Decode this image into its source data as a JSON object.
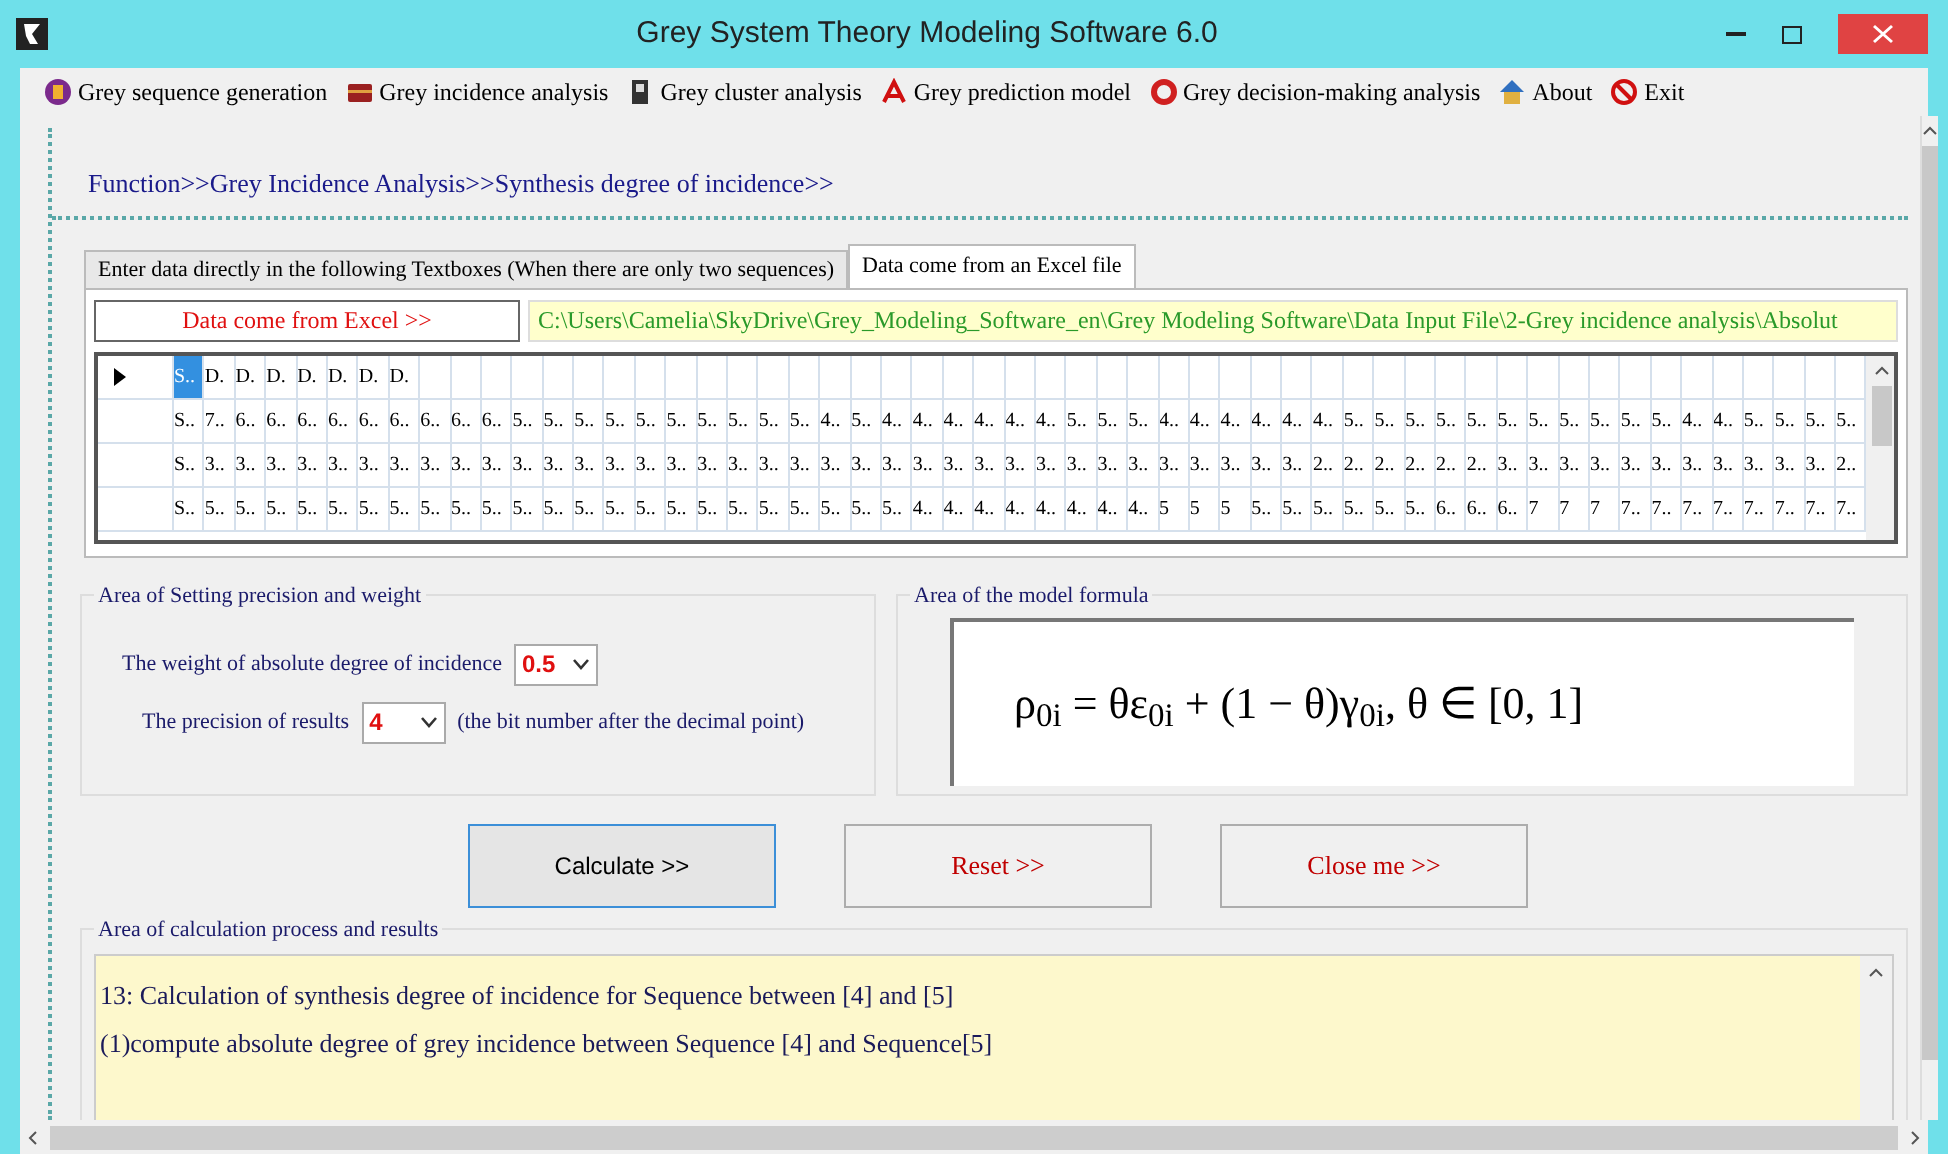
{
  "window": {
    "title": "Grey System Theory Modeling Software 6.0"
  },
  "menu": [
    {
      "label": "Grey sequence generation"
    },
    {
      "label": "Grey incidence analysis"
    },
    {
      "label": "Grey cluster analysis"
    },
    {
      "label": "Grey prediction model"
    },
    {
      "label": "Grey decision-making analysis"
    },
    {
      "label": "About"
    },
    {
      "label": "Exit"
    }
  ],
  "breadcrumb": "Function>>Grey Incidence Analysis>>Synthesis degree of incidence>>",
  "tabs": [
    {
      "label": "Enter data directly in the following Textboxes (When there are only two sequences)",
      "selected": false
    },
    {
      "label": "Data come from an Excel file",
      "selected": true
    }
  ],
  "excel_button": "Data come from Excel >>",
  "file_path": "C:\\Users\\Camelia\\SkyDrive\\Grey_Modeling_Software_en\\Grey Modeling Software\\Data Input File\\2-Grey incidence analysis\\Absolut",
  "grid": {
    "rows": [
      {
        "selected": true,
        "cells": [
          "S..",
          "D.",
          "D.",
          "D.",
          "D.",
          "D.",
          "D.",
          "D."
        ]
      },
      {
        "selected": false,
        "cells": [
          "S..",
          "7..",
          "6..",
          "6..",
          "6..",
          "6..",
          "6..",
          "6..",
          "6..",
          "6..",
          "6..",
          "5..",
          "5..",
          "5..",
          "5..",
          "5..",
          "5..",
          "5..",
          "5..",
          "5..",
          "5..",
          "4..",
          "5..",
          "4..",
          "4..",
          "4..",
          "4..",
          "4..",
          "4..",
          "5..",
          "5..",
          "5..",
          "4..",
          "4..",
          "4..",
          "4..",
          "4..",
          "4..",
          "5..",
          "5..",
          "5..",
          "5..",
          "5..",
          "5..",
          "5..",
          "5..",
          "5..",
          "5..",
          "5..",
          "4..",
          "4..",
          "5..",
          "5..",
          "5..",
          "5.."
        ]
      },
      {
        "selected": false,
        "cells": [
          "S..",
          "3..",
          "3..",
          "3..",
          "3..",
          "3..",
          "3..",
          "3..",
          "3..",
          "3..",
          "3..",
          "3..",
          "3..",
          "3..",
          "3..",
          "3..",
          "3..",
          "3..",
          "3..",
          "3..",
          "3..",
          "3..",
          "3..",
          "3..",
          "3..",
          "3..",
          "3..",
          "3..",
          "3..",
          "3..",
          "3..",
          "3..",
          "3..",
          "3..",
          "3..",
          "3..",
          "3..",
          "2..",
          "2..",
          "2..",
          "2..",
          "2..",
          "2..",
          "3..",
          "3..",
          "3..",
          "3..",
          "3..",
          "3..",
          "3..",
          "3..",
          "3..",
          "3..",
          "3..",
          "2.."
        ]
      },
      {
        "selected": false,
        "cells": [
          "S..",
          "5..",
          "5..",
          "5..",
          "5..",
          "5..",
          "5..",
          "5..",
          "5..",
          "5..",
          "5..",
          "5..",
          "5..",
          "5..",
          "5..",
          "5..",
          "5..",
          "5..",
          "5..",
          "5..",
          "5..",
          "5..",
          "5..",
          "5..",
          "4..",
          "4..",
          "4..",
          "4..",
          "4..",
          "4..",
          "4..",
          "4..",
          "5",
          "5",
          "5",
          "5..",
          "5..",
          "5..",
          "5..",
          "5..",
          "5..",
          "6..",
          "6..",
          "6..",
          "7",
          "7",
          "7",
          "7..",
          "7..",
          "7..",
          "7..",
          "7..",
          "7..",
          "7..",
          "7.."
        ]
      }
    ]
  },
  "settings": {
    "title": "Area of  Setting  precision and weight",
    "weight": {
      "label": "The weight of absolute degree of incidence",
      "value": "0.5"
    },
    "precision": {
      "label": "The precision of results",
      "value": "4",
      "note": "(the bit number after the decimal point)"
    }
  },
  "formula": {
    "title": "Area of the model formula",
    "text": "ρ$_{0i}$ = θε$_{0i}$ + (1 − θ)γ$_{0i}$,  θ ∈ [0, 1]"
  },
  "buttons": [
    {
      "label": "Calculate >>",
      "kind": "primary"
    },
    {
      "label": "Reset >>",
      "kind": "danger"
    },
    {
      "label": "Close me >>",
      "kind": "danger"
    }
  ],
  "results": {
    "title": "Area of calculation process and results",
    "lines": [
      "13:  Calculation of synthesis degree of incidence for Sequence between [4]  and [5]",
      "(1)compute absolute degree of grey incidence between Sequence [4]   and  Sequence[5]"
    ]
  }
}
